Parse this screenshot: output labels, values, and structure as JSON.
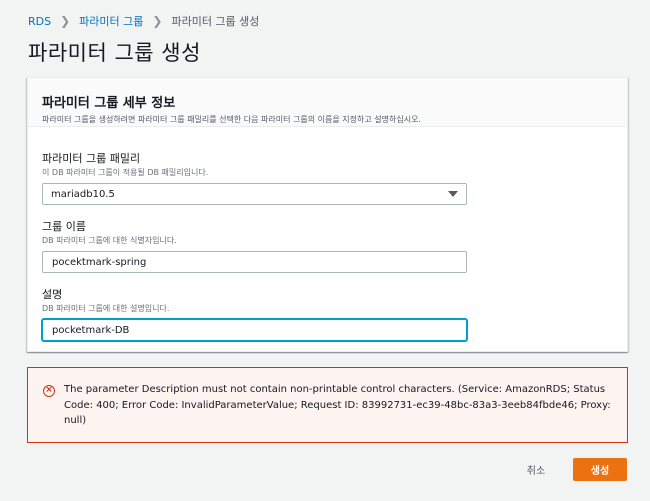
{
  "breadcrumb": {
    "items": [
      "RDS",
      "파라미터 그룹",
      "파라미터 그룹 생성"
    ]
  },
  "page": {
    "title": "파라미터 그룹 생성"
  },
  "panel": {
    "title": "파라미터 그룹 세부 정보",
    "description": "파라미터 그룹을 생성하려면 파라미터 그룹 패밀리를 선택한 다음 파라미터 그룹의 이름을 지정하고 설명하십시오."
  },
  "form": {
    "family": {
      "label": "파라미터 그룹 패밀리",
      "description": "이 DB 파라미터 그룹이 적용될 DB 패밀리입니다.",
      "value": "mariadb10.5"
    },
    "group_name": {
      "label": "그룹 이름",
      "description": "DB 파라미터 그룹에 대한 식별자입니다.",
      "value": "pocektmark-spring"
    },
    "description": {
      "label": "설명",
      "description": "DB 파라미터 그룹에 대한 설명입니다.",
      "value": "pocketmark-DB"
    }
  },
  "error": {
    "icon": "error-x-circle-icon",
    "message": "The parameter Description must not contain non-printable control characters. (Service: AmazonRDS; Status Code: 400; Error Code: InvalidParameterValue; Request ID: 83992731-ec39-48bc-83a3-3eeb84fbde46; Proxy: null)"
  },
  "actions": {
    "cancel_label": "취소",
    "create_label": "생성"
  },
  "colors": {
    "link": "#0073bb",
    "primary": "#ec7211",
    "error": "#d13212",
    "focus": "#00a1c9"
  }
}
